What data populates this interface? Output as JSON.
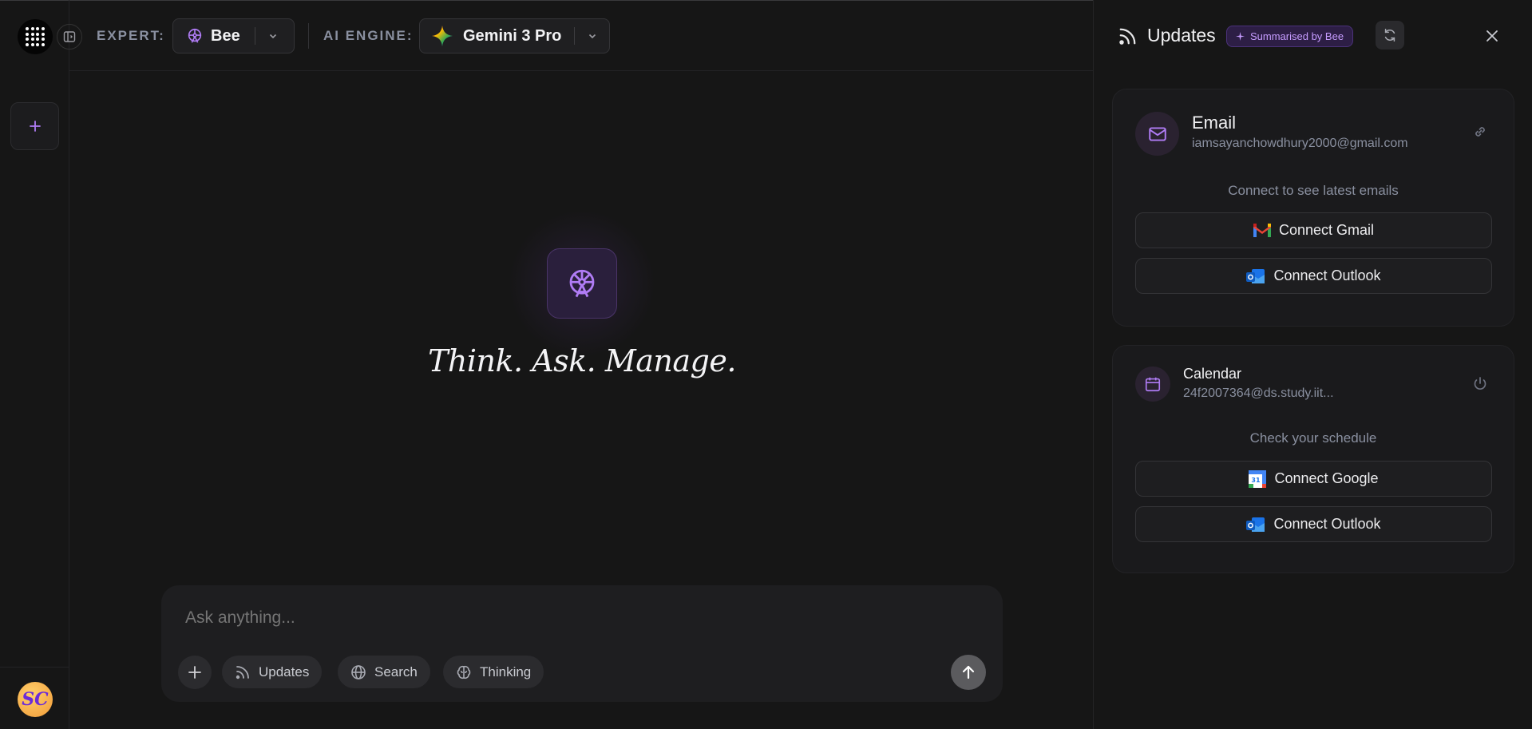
{
  "header": {
    "expert_label": "EXPERT:",
    "expert_value": "Bee",
    "engine_label": "AI ENGINE:",
    "engine_value": "Gemini 3 Pro"
  },
  "hero": {
    "tagline": "Think. Ask. Manage."
  },
  "composer": {
    "placeholder": "Ask anything...",
    "chips": {
      "updates": "Updates",
      "search": "Search",
      "thinking": "Thinking"
    }
  },
  "user": {
    "initials": "SC"
  },
  "updates_panel": {
    "title": "Updates",
    "badge": "Summarised by Bee",
    "email_card": {
      "title": "Email",
      "account": "iamsayanchowdhury2000@gmail.com",
      "hint": "Connect to see latest emails",
      "buttons": [
        "Connect Gmail",
        "Connect Outlook"
      ]
    },
    "calendar_card": {
      "title": "Calendar",
      "account": "24f2007364@ds.study.iit...",
      "hint": "Check your schedule",
      "buttons": [
        "Connect Google",
        "Connect Outlook"
      ]
    }
  },
  "colors": {
    "accent": "#a874f0",
    "background": "#161616",
    "card": "#1a1a1c"
  }
}
